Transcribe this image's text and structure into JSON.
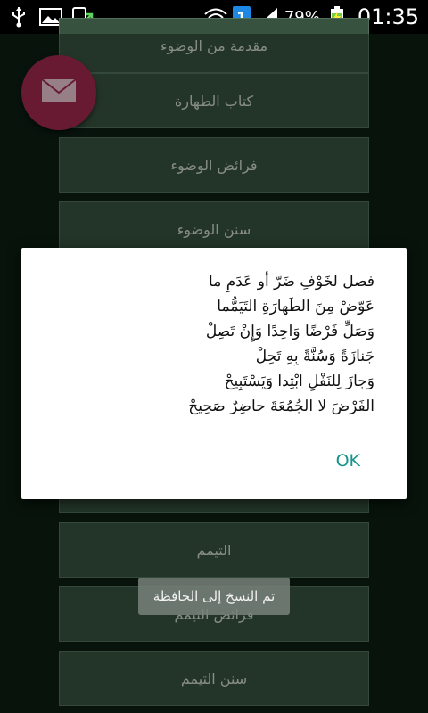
{
  "status_bar": {
    "battery": "79%",
    "time": "01:35",
    "notification_badge": "1",
    "icons": [
      "usb-icon",
      "image-icon",
      "screen-update-icon",
      "wifi-icon",
      "signal-icon",
      "battery-charging-icon"
    ]
  },
  "list": {
    "items": [
      "مقدمة من الوضوء",
      "كتاب الطهارة",
      "فرائض الوضوء",
      "سنن الوضوء",
      "",
      "التيمم",
      "فرائض التيمم",
      "سنن التيمم"
    ]
  },
  "dialog": {
    "lines": [
      "فصل لخَوْفِ ضَرّ أو عَدَمِ ما",
      "عَوّضْ مِنَ الطَهارَةِ التَيَمُّما",
      "وَصَلِّ فَرْضًا وَاحِدًا وَإِنْ تَصِلْ",
      "جَنازَةً وَسُنَّةً بِهِ تَحِلْ",
      "وَجازَ لِلنَفْلِ ابْتِدا وَيَسْتَبِيحْ",
      "الفَرْضَ لا الجُمُعَةَ حاضِرٌ صَحِيحْ"
    ],
    "ok_label": "OK"
  },
  "toast": {
    "text": "تم النسخ إلى الحافظة"
  },
  "colors": {
    "background": "#0b1e12",
    "list_item": "#37523e",
    "fab": "#a0294f",
    "ok_button": "#15958c"
  }
}
